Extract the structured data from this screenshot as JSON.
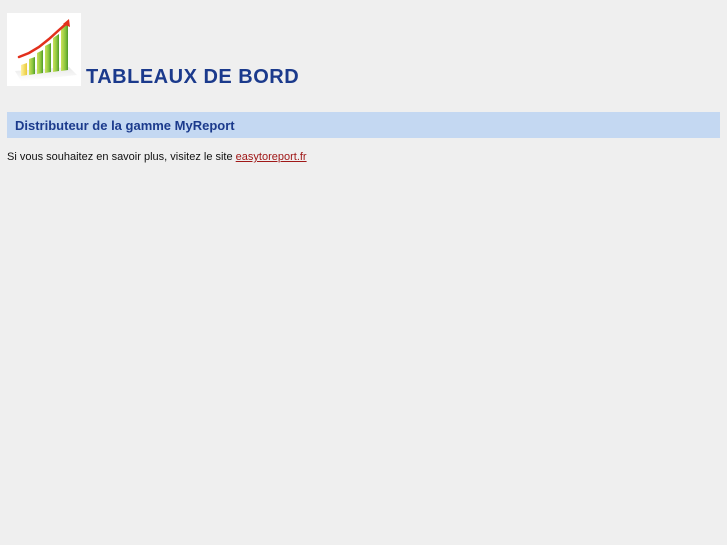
{
  "header": {
    "logo_icon": "growth-chart-icon",
    "title": "TABLEAUX DE BORD"
  },
  "banner": {
    "text": "Distributeur de la gamme MyReport"
  },
  "info": {
    "text": "Si vous souhaitez en savoir plus, visitez le site",
    "link_label": "easytoreport.fr"
  },
  "colors": {
    "background": "#efefef",
    "title": "#1b3a8c",
    "banner": "#c4d8f2",
    "link": "#a01818"
  }
}
